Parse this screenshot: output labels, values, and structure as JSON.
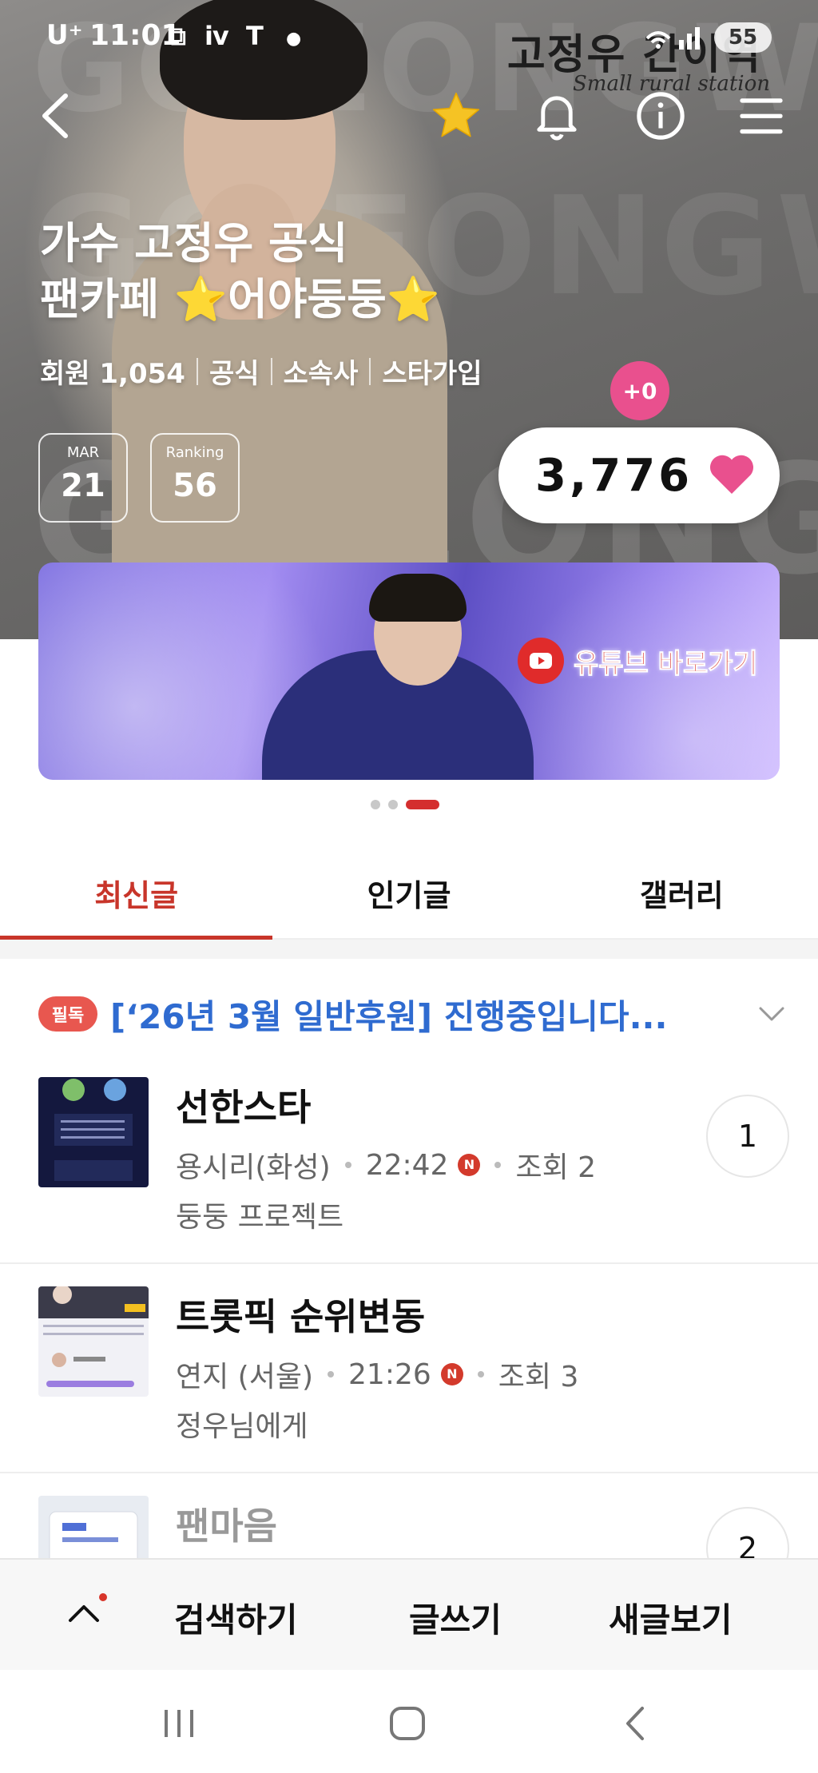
{
  "status_bar": {
    "carrier": "U⁺",
    "time": "11:01",
    "battery": "55"
  },
  "hero": {
    "logo_title": "고정우 간이역",
    "logo_sub": "Small rural station",
    "title_line1": "가수 고정우 공식",
    "title_line2": "팬카페 ⭐어야둥둥⭐",
    "meta": {
      "members": "회원 1,054",
      "official": "공식",
      "agency": "소속사",
      "star_join": "스타가입"
    },
    "month_box": {
      "label": "MAR",
      "value": "21"
    },
    "ranking_box": {
      "label": "Ranking",
      "value": "56"
    },
    "plus_badge": "+0",
    "like_count": "3,776",
    "colors": {
      "heart": "#e9508e",
      "star": "#f5c324"
    }
  },
  "banner": {
    "youtube_label": "유튜브 바로가기",
    "page_dots": 3,
    "active_dot": 3
  },
  "tabs": [
    {
      "label": "최신글",
      "active": true
    },
    {
      "label": "인기글",
      "active": false
    },
    {
      "label": "갤러리",
      "active": false
    }
  ],
  "notice": {
    "badge": "필독",
    "text": "[‘26년 3월 일반후원] 진행중입니다..."
  },
  "posts": [
    {
      "title": "선한스타",
      "author": "용시리(화성)",
      "time": "22:42",
      "new_badge": "N",
      "views": "조회 2",
      "sub": "둥둥 프로젝트",
      "comments": "1"
    },
    {
      "title": "트롯픽 순위변동",
      "author": "연지 (서울)",
      "time": "21:26",
      "new_badge": "N",
      "views": "조회 3",
      "sub": "정우님에게",
      "comments": ""
    },
    {
      "title": "팬마음",
      "author": "",
      "time": "",
      "new_badge": "",
      "views": "",
      "sub": "",
      "comments": "2"
    }
  ],
  "action_bar": {
    "search": "검색하기",
    "write": "글쓰기",
    "new_posts": "새글보기"
  },
  "icons": {
    "back": "chevron-left-icon",
    "favorite": "star-icon",
    "notifications": "bell-icon",
    "info": "info-icon",
    "menu": "hamburger-menu-icon"
  }
}
